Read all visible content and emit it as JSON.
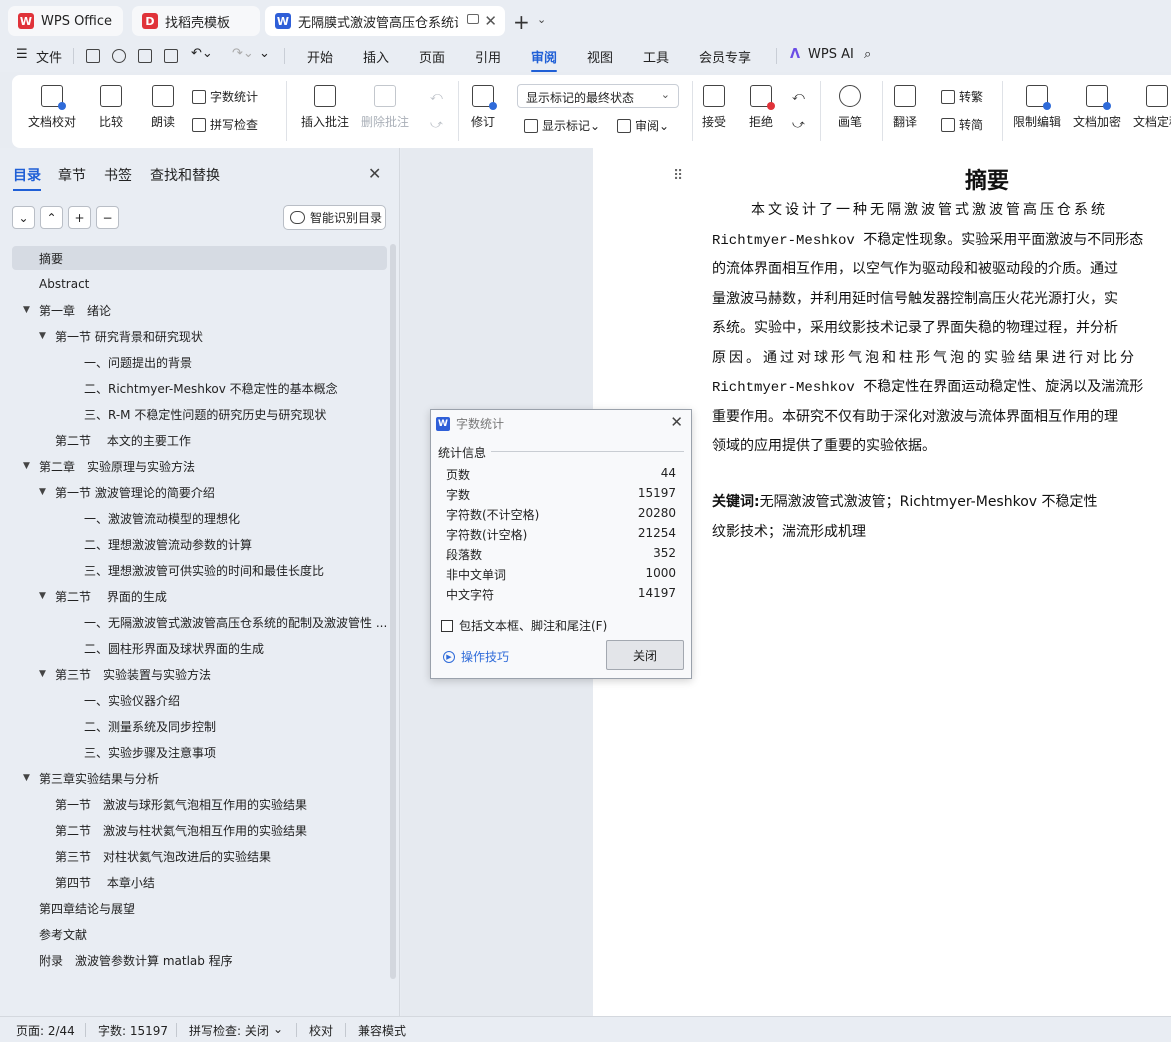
{
  "tabs": [
    {
      "label": "WPS Office",
      "icon": "wps-logo-icon",
      "color": "#e0333a"
    },
    {
      "label": "找稻壳模板",
      "icon": "docer-icon",
      "color": "#e0333a"
    },
    {
      "label": "无隔膜式激波管高压仓系统设计",
      "icon": "word-doc-icon",
      "color": "#2f5fd8"
    }
  ],
  "menu": {
    "file": "文件",
    "items": [
      "开始",
      "插入",
      "页面",
      "引用",
      "审阅",
      "视图",
      "工具",
      "会员专享"
    ],
    "active": "审阅",
    "wps_ai": "WPS AI"
  },
  "ribbon": {
    "doc_proofread": "文档校对",
    "compare": "比较",
    "read_aloud": "朗读",
    "word_count": "字数统计",
    "spell_check": "拼写检查",
    "insert_comment": "插入批注",
    "delete_comment": "删除批注",
    "revise": "修订",
    "markup_view": "显示标记的最终状态",
    "show_markup": "显示标记",
    "review": "审阅",
    "accept": "接受",
    "reject": "拒绝",
    "pen": "画笔",
    "translate": "翻译",
    "to_traditional": "转繁",
    "to_simplified": "转简",
    "restrict_edit": "限制编辑",
    "encrypt": "文档加密",
    "finalize": "文档定稿"
  },
  "nav": {
    "tabs": [
      "目录",
      "章节",
      "书签",
      "查找和替换"
    ],
    "active_tab": "目录",
    "smart_toc": "智能识别目录",
    "toc": [
      {
        "text": "摘要",
        "level": 0,
        "arrow": false,
        "selected": true
      },
      {
        "text": "Abstract",
        "level": 0,
        "arrow": false
      },
      {
        "text": "第一章　绪论",
        "level": 0,
        "arrow": true
      },
      {
        "text": "第一节  研究背景和研究现状",
        "level": 1,
        "arrow": true
      },
      {
        "text": "一、问题提出的背景",
        "level": 2,
        "arrow": false
      },
      {
        "text": "二、Richtmyer-Meshkov 不稳定性的基本概念",
        "level": 2,
        "arrow": false
      },
      {
        "text": "三、R-M 不稳定性问题的研究历史与研究现状",
        "level": 2,
        "arrow": false
      },
      {
        "text": "第二节　 本文的主要工作",
        "level": 1,
        "arrow": false
      },
      {
        "text": "第二章　实验原理与实验方法",
        "level": 0,
        "arrow": true
      },
      {
        "text": "第一节  激波管理论的简要介绍",
        "level": 1,
        "arrow": true
      },
      {
        "text": "一、激波管流动模型的理想化",
        "level": 2,
        "arrow": false
      },
      {
        "text": "二、理想激波管流动参数的计算",
        "level": 2,
        "arrow": false
      },
      {
        "text": "三、理想激波管可供实验的时间和最佳长度比",
        "level": 2,
        "arrow": false
      },
      {
        "text": "第二节　 界面的生成",
        "level": 1,
        "arrow": true
      },
      {
        "text": "一、无隔激波管式激波管高压仓系统的配制及激波管性 ...",
        "level": 2,
        "arrow": false
      },
      {
        "text": "二、圆柱形界面及球状界面的生成",
        "level": 2,
        "arrow": false
      },
      {
        "text": "第三节　实验装置与实验方法",
        "level": 1,
        "arrow": true
      },
      {
        "text": "一、实验仪器介绍",
        "level": 2,
        "arrow": false
      },
      {
        "text": "二、测量系统及同步控制",
        "level": 2,
        "arrow": false
      },
      {
        "text": "三、实验步骤及注意事项",
        "level": 2,
        "arrow": false
      },
      {
        "text": "第三章实验结果与分析",
        "level": 0,
        "arrow": true
      },
      {
        "text": "第一节　激波与球形氦气泡相互作用的实验结果",
        "level": 1,
        "arrow": false
      },
      {
        "text": "第二节　激波与柱状氦气泡相互作用的实验结果",
        "level": 1,
        "arrow": false
      },
      {
        "text": "第三节　对柱状氦气泡改进后的实验结果",
        "level": 1,
        "arrow": false
      },
      {
        "text": "第四节　 本章小结",
        "level": 1,
        "arrow": false
      },
      {
        "text": "第四章结论与展望",
        "level": 0,
        "arrow": false
      },
      {
        "text": "参考文献",
        "level": 0,
        "arrow": false
      },
      {
        "text": "附录　激波管参数计算 matlab 程序",
        "level": 0,
        "arrow": false
      }
    ]
  },
  "document": {
    "title": "摘要",
    "lines": [
      {
        "text": "本文设计了一种无隔激波管式激波管高压仓系统",
        "mono": false,
        "indent": true
      },
      {
        "text": "Richtmyer-Meshkov 不稳定性现象。实验采用平面激波与不同形态",
        "mono": true,
        "indent": false
      },
      {
        "text": "的流体界面相互作用，以空气作为驱动段和被驱动段的介质。通过",
        "mono": false,
        "indent": false
      },
      {
        "text": "量激波马赫数，并利用延时信号触发器控制高压火花光源打火，实",
        "mono": false,
        "indent": false
      },
      {
        "text": "系统。实验中，采用纹影技术记录了界面失稳的物理过程，并分析",
        "mono": false,
        "indent": false
      },
      {
        "text": "原因。通过对球形气泡和柱形气泡的实验结果进行对比分",
        "mono": false,
        "indent": false
      },
      {
        "text": "Richtmyer-Meshkov 不稳定性在界面运动稳定性、旋涡以及湍流形",
        "mono": true,
        "indent": false
      },
      {
        "text": "重要作用。本研究不仅有助于深化对激波与流体界面相互作用的理",
        "mono": false,
        "indent": false
      },
      {
        "text": "领域的应用提供了重要的实验依据。",
        "mono": false,
        "indent": false
      }
    ],
    "keywords_label": "关键词:",
    "keywords_line1": "无隔激波管式激波管；Richtmyer-Meshkov 不稳定性",
    "keywords_line2": "纹影技术；湍流形成机理"
  },
  "dialog": {
    "title": "字数统计",
    "section": "统计信息",
    "stats": [
      {
        "label": "页数",
        "value": "44"
      },
      {
        "label": "字数",
        "value": "15197"
      },
      {
        "label": "字符数(不计空格)",
        "value": "20280"
      },
      {
        "label": "字符数(计空格)",
        "value": "21254"
      },
      {
        "label": "段落数",
        "value": "352"
      },
      {
        "label": "非中文单词",
        "value": "1000"
      },
      {
        "label": "中文字符",
        "value": "14197"
      }
    ],
    "checkbox": "包括文本框、脚注和尾注(F)",
    "tips": "操作技巧",
    "close": "关闭"
  },
  "status": {
    "page": "页面: 2/44",
    "words": "字数: 15197",
    "spell": "拼写检查: 关闭",
    "proof": "校对",
    "compat": "兼容模式"
  }
}
